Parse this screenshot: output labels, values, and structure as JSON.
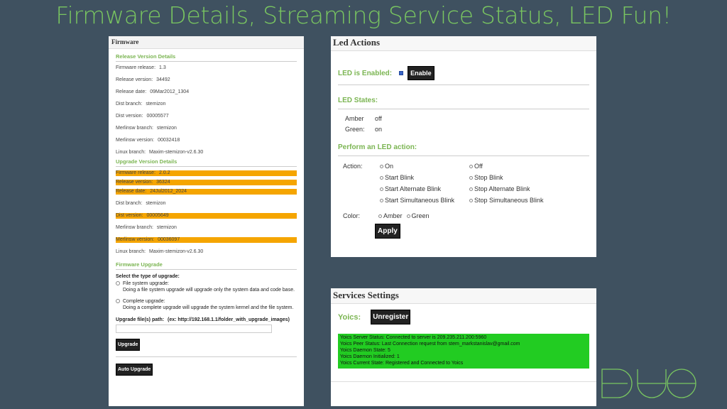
{
  "slide": {
    "title": "Firmware Details, Streaming Service Status, LED Fun!"
  },
  "firmware": {
    "title": "Firmware",
    "release_section": "Release Version Details",
    "release_rows": [
      {
        "label": "Firmware release:",
        "value": "1.3"
      },
      {
        "label": "Release version:",
        "value": "34492"
      },
      {
        "label": "Release date:",
        "value": "09Mar2012_1304"
      },
      {
        "label": "Dist branch:",
        "value": "stemizon"
      },
      {
        "label": "Dist version:",
        "value": "00005577"
      },
      {
        "label": "Merlinsw branch:",
        "value": "stemizon"
      },
      {
        "label": "Merlinsw version:",
        "value": "00032418"
      },
      {
        "label": "Linux branch:",
        "value": "Maxim-stemizon-v2.6.30"
      }
    ],
    "upgrade_section": "Upgrade Version Details",
    "upgrade_rows": [
      {
        "label": "Firmware release:",
        "value": "2.0.2"
      },
      {
        "label": "Release version:",
        "value": "36324"
      },
      {
        "label": "Release date:",
        "value": "24Jul2012_2024"
      },
      {
        "label": "Dist branch:",
        "value": "stemizon"
      },
      {
        "label": "Dist version:",
        "value": "00005649"
      },
      {
        "label": "Merlinsw branch:",
        "value": "stemizon"
      },
      {
        "label": "Merlinsw version:",
        "value": "00036097"
      },
      {
        "label": "Linux branch:",
        "value": "Maxim-stemizon-v2.6.30"
      }
    ],
    "highlight_color": "#f5a500",
    "fw_upgrade_section": "Firmware Upgrade",
    "select_type_label": "Select the type of upgrade:",
    "option_fs_label": "File system upgrade:",
    "option_fs_desc": "Doing a file system upgrade will upgrade only the system data and code base.",
    "option_complete_label": "Complete upgrade:",
    "option_complete_desc": "Doing a complete upgrade will upgrade the system kernel and the file system.",
    "path_label": "Upgrade file(s) path:",
    "path_hint": "(ex: http://192.168.1.1/folder_with_upgrade_images)",
    "path_value": "",
    "upgrade_button": "Upgrade",
    "auto_upgrade_button": "Auto Upgrade"
  },
  "led": {
    "title": "Led Actions",
    "enabled_label": "LED is Enabled:",
    "enable_button": "Enable",
    "states_section": "LED States:",
    "states": [
      {
        "name": "Amber",
        "value": "off"
      },
      {
        "name": "Green:",
        "value": "on"
      }
    ],
    "perform_section": "Perform an LED action:",
    "action_label": "Action:",
    "actions": [
      [
        "On",
        "Off"
      ],
      [
        "Start Blink",
        "Stop Blink"
      ],
      [
        "Start Alternate Blink",
        "Stop Alternate Blink"
      ],
      [
        "Start Simultaneous Blink",
        "Stop Simultaneous Blink"
      ]
    ],
    "color_label": "Color:",
    "colors": [
      "Amber",
      "Green"
    ],
    "apply_button": "Apply"
  },
  "services": {
    "title": "Services Settings",
    "yoics_label": "Yoics:",
    "unregister_button": "Unregister",
    "status_color": "#22cc22",
    "status_lines": [
      "Yoics Server Status: Connected to server is 209.235.211.200:5960",
      "Yoics Peer Status: Last Connection request from stem_markstanislav@gmail.com",
      "Yoics Daemon State: 5",
      "Yoics Daemon Initialized: 1",
      "Yoics Current State: Registered and Connected to Yoics"
    ]
  },
  "logo": {
    "icon": "duo-logo-icon"
  }
}
